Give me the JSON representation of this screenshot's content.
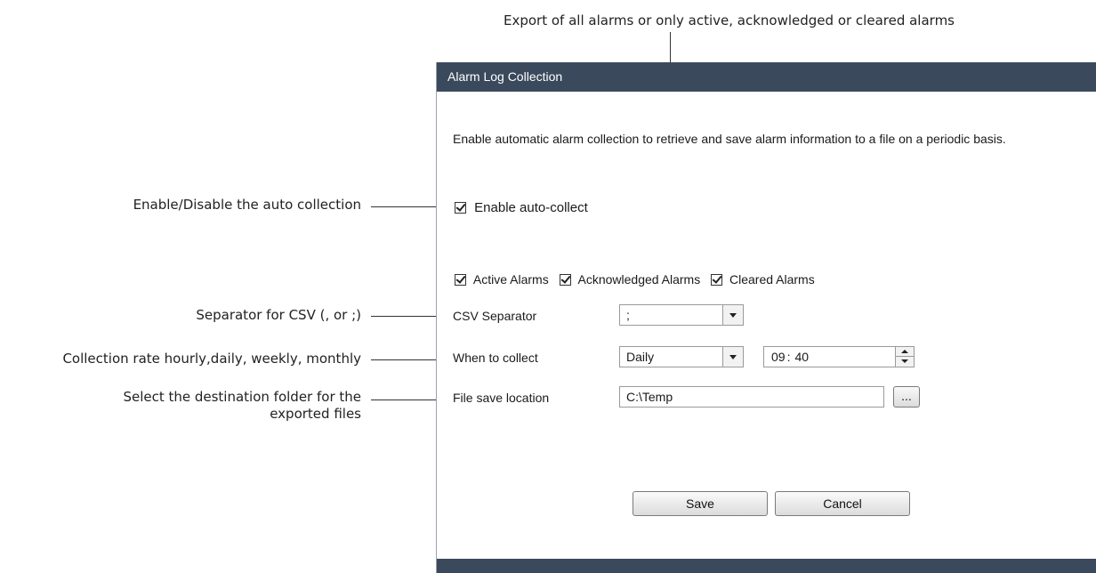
{
  "callouts": {
    "export_filter": "Export of all alarms or only active, acknowledged or cleared alarms",
    "enable_toggle": "Enable/Disable the auto collection",
    "separator": "Separator for CSV (, or ;)",
    "rate": "Collection rate hourly,daily, weekly, monthly",
    "destination_line1": "Select the destination folder for the",
    "destination_line2": "exported files"
  },
  "panel": {
    "title": "Alarm Log Collection",
    "description": "Enable automatic alarm collection to retrieve and save alarm information to a file on a periodic basis.",
    "enable_auto_collect": {
      "label": "Enable auto-collect",
      "checked": true
    },
    "filters": [
      {
        "label": "Active Alarms",
        "checked": true
      },
      {
        "label": "Acknowledged Alarms",
        "checked": true
      },
      {
        "label": "Cleared Alarms",
        "checked": true
      }
    ],
    "csv_separator": {
      "label": "CSV Separator",
      "value": ";"
    },
    "when_to_collect": {
      "label": "When to collect",
      "value": "Daily",
      "time_hour": "09",
      "time_sep": ":",
      "time_minute": "40"
    },
    "file_save_location": {
      "label": "File save location",
      "value": "C:\\Temp",
      "browse_label": "..."
    },
    "buttons": {
      "save": "Save",
      "cancel": "Cancel"
    }
  },
  "colors": {
    "titlebar": "#3a4a5c",
    "titlebar_text": "#ffffff"
  }
}
